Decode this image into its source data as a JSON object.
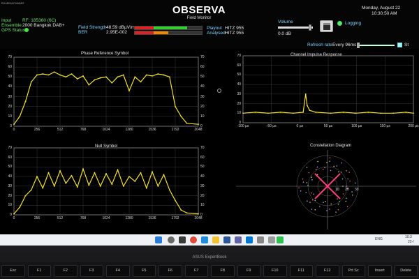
{
  "app": {
    "logo_text": "ROHDE&SCHWARZ",
    "title": "OBSERVA",
    "subtitle": "Field Monitor"
  },
  "header": {
    "input_label": "Input",
    "input_value": "RF: 185360 (6C)",
    "ensemble_label": "Ensemble",
    "ensemble_value": "2000 Bangkok DAB+",
    "gps_label": "GPS Status",
    "field_strength_label": "Field Strength",
    "field_strength_value": "48.59 dBµV/m",
    "field_strength_level": 0.78,
    "ber_label": "BER",
    "ber_value": "2.95E-002",
    "ber_level": 0.5,
    "playout_label": "Playout",
    "playout_value": "HITZ 955",
    "analysed_label": "Analysed",
    "analysed_value": "HITZ 955",
    "volume_label": "Volume",
    "volume_value": "0.0 dB",
    "volume_level": 0.9,
    "logging_label": "Logging",
    "refresh_label": "Refresh rate",
    "refresh_value": "Every 96ms",
    "stop_label": "St",
    "date_text": "Monday, August 22",
    "time_text": "10:30:50 AM"
  },
  "charts": {
    "phase": {
      "title": "Phase Reference Symbol",
      "xticks": [
        "0",
        "256",
        "512",
        "768",
        "1024",
        "1280",
        "1536",
        "1792",
        "2048"
      ],
      "yticks": [
        "0",
        "10",
        "20",
        "30",
        "40",
        "50",
        "60",
        "70"
      ]
    },
    "null": {
      "title": "Null Symbol",
      "xticks": [
        "0",
        "256",
        "512",
        "768",
        "1024",
        "1280",
        "1536",
        "1792",
        "2048"
      ],
      "yticks": [
        "0",
        "10",
        "20",
        "30",
        "40",
        "50",
        "60",
        "70"
      ]
    },
    "cir": {
      "title": "Channel Impulse Response",
      "xticks": [
        "-100 µs",
        "-50 µs",
        "0 µs",
        "50 µs",
        "100 µs",
        "150 µs",
        "200 µs"
      ],
      "yticks": [
        "0",
        "10",
        "20",
        "30",
        "40",
        "50",
        "60",
        "70"
      ]
    },
    "constellation": {
      "title": "Constellation Diagram",
      "ticks": [
        "10",
        "20",
        "30"
      ]
    }
  },
  "chart_data": [
    {
      "type": "line",
      "title": "Phase Reference Symbol",
      "xlim": [
        0,
        2048
      ],
      "ylim": [
        0,
        70
      ],
      "x": [
        0,
        64,
        128,
        192,
        256,
        320,
        384,
        448,
        512,
        576,
        640,
        704,
        768,
        832,
        896,
        960,
        1024,
        1088,
        1152,
        1216,
        1280,
        1344,
        1408,
        1472,
        1536,
        1600,
        1664,
        1728,
        1792,
        1856,
        1920,
        2048
      ],
      "series": [
        {
          "values": [
            2,
            10,
            25,
            45,
            52,
            53,
            52,
            55,
            52,
            50,
            53,
            48,
            51,
            42,
            47,
            49,
            50,
            44,
            50,
            52,
            36,
            50,
            45,
            52,
            51,
            53,
            52,
            50,
            20,
            10,
            3,
            2
          ],
          "color": "#f5e22a"
        }
      ]
    },
    {
      "type": "line",
      "title": "Null Symbol",
      "xlim": [
        0,
        2048
      ],
      "ylim": [
        0,
        70
      ],
      "x": [
        0,
        64,
        128,
        192,
        256,
        320,
        384,
        448,
        512,
        576,
        640,
        704,
        768,
        832,
        896,
        960,
        1024,
        1088,
        1152,
        1216,
        1280,
        1344,
        1408,
        1472,
        1536,
        1600,
        1664,
        1728,
        1792,
        1856,
        1920,
        2048
      ],
      "series": [
        {
          "values": [
            1,
            8,
            20,
            26,
            40,
            28,
            44,
            30,
            46,
            33,
            41,
            29,
            48,
            31,
            44,
            30,
            43,
            32,
            47,
            30,
            40,
            35,
            44,
            28,
            45,
            30,
            42,
            26,
            15,
            5,
            2,
            1
          ],
          "color": "#f5e22a"
        }
      ]
    },
    {
      "type": "line",
      "title": "Channel Impulse Response",
      "x": [
        -125,
        -100,
        -75,
        -50,
        -25,
        -5,
        0,
        3,
        8,
        20,
        50,
        75,
        100,
        125,
        150,
        175,
        200,
        215
      ],
      "series": [
        {
          "values": [
            10,
            11,
            10,
            11,
            10,
            11,
            30,
            18,
            13,
            11,
            10,
            11,
            10,
            11,
            10,
            10,
            11,
            10
          ],
          "color": "#f5e22a"
        }
      ],
      "ylim": [
        0,
        70
      ]
    },
    {
      "type": "scatter",
      "title": "Constellation Diagram",
      "ticks": [
        "10",
        "20",
        "30"
      ]
    }
  ],
  "taskbar": {
    "tray_lang": "ENG",
    "tray_time": "10:3",
    "tray_date": "22-/"
  },
  "laptop": {
    "brand": "ASUS ExpertBook",
    "keys": [
      "Esc",
      "F1",
      "F2",
      "F3",
      "F4",
      "F5",
      "F6",
      "F7",
      "F8",
      "F9",
      "F10",
      "F11",
      "F12",
      "Prt Sc",
      "Insert",
      "Delete"
    ]
  }
}
